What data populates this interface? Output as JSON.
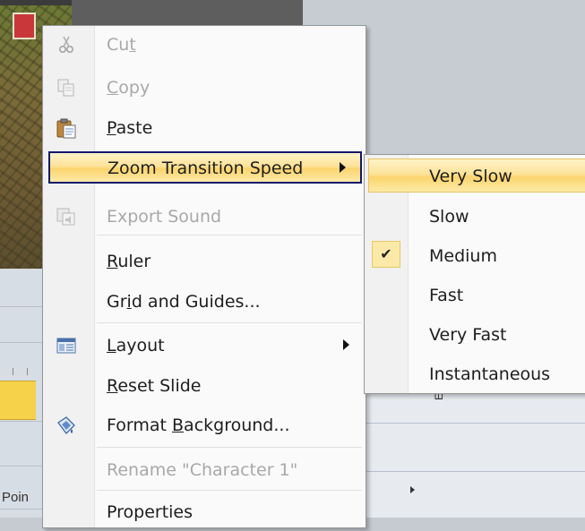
{
  "background": {
    "left_edge_label": "Poin",
    "rotated_label": "Em"
  },
  "context_menu": {
    "items": [
      {
        "label": "Cut",
        "icon": "scissors-icon",
        "enabled": false,
        "accesskey_index": 2
      },
      {
        "label": "Copy",
        "icon": "copy-icon",
        "enabled": false,
        "accesskey_index": 0
      },
      {
        "label": "Paste",
        "icon": "paste-icon",
        "enabled": true,
        "accesskey_index": 0
      },
      {
        "label": "Zoom Transition Speed",
        "icon": null,
        "enabled": true,
        "highlighted": true,
        "submenu": true
      },
      {
        "label": "Export Sound",
        "icon": "export-sound-icon",
        "enabled": false
      },
      {
        "label": "Ruler",
        "icon": null,
        "enabled": true,
        "accesskey_index": 0
      },
      {
        "label": "Grid and Guides...",
        "icon": null,
        "enabled": true,
        "accesskey_index": 2
      },
      {
        "label": "Layout",
        "icon": "layout-icon",
        "enabled": true,
        "submenu": true,
        "accesskey_index": 0
      },
      {
        "label": "Reset Slide",
        "icon": null,
        "enabled": true,
        "accesskey_index": 0
      },
      {
        "label": "Format Background...",
        "icon": "format-background-icon",
        "enabled": true,
        "accesskey_index": 7
      },
      {
        "label": "Rename \"Character 1\"",
        "icon": null,
        "enabled": false
      },
      {
        "label": "Properties",
        "icon": null,
        "enabled": true
      }
    ]
  },
  "submenu": {
    "title": "Zoom Transition Speed",
    "items": [
      {
        "label": "Very Slow",
        "highlighted": true,
        "checked": false
      },
      {
        "label": "Slow",
        "checked": false
      },
      {
        "label": "Medium",
        "checked": true
      },
      {
        "label": "Fast",
        "checked": false
      },
      {
        "label": "Very Fast",
        "checked": false
      },
      {
        "label": "Instantaneous",
        "checked": false
      }
    ],
    "check_glyph": "✔"
  },
  "colors": {
    "highlight_top": "#fff3c7",
    "highlight_bottom": "#fbd56d",
    "highlight_border": "#10186b",
    "disabled_text": "#a8a8a8"
  }
}
